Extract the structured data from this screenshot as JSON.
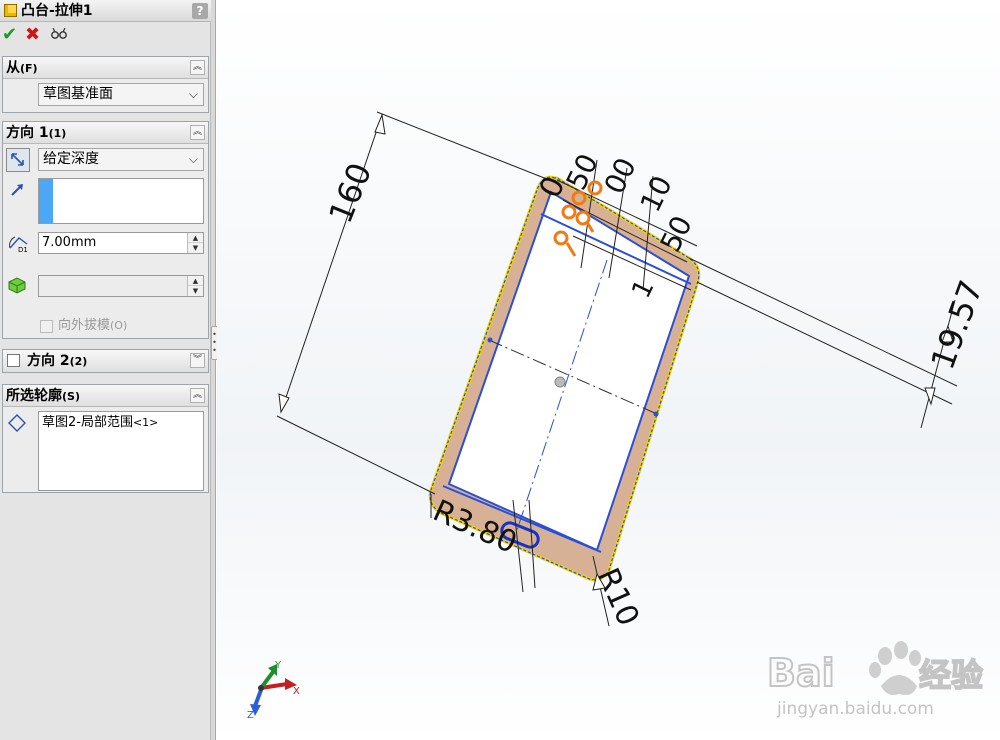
{
  "feature": {
    "title": "凸台-拉伸1",
    "help_glyph": "?"
  },
  "actions": {
    "ok_glyph": "✔",
    "cancel_glyph": "✖",
    "preview_glyph": "6̸6"
  },
  "from_group": {
    "title": "从",
    "shortcut": "(F)",
    "selected": "草图基准面"
  },
  "direction1": {
    "title": "方向 1",
    "shortcut": "(1)",
    "end_condition": "给定深度",
    "depth": "7.00mm",
    "draft_label": "向外拔模",
    "draft_shortcut": "(O)"
  },
  "direction2": {
    "title": "方向 2",
    "shortcut": "(2)"
  },
  "contours": {
    "title": "所选轮廓",
    "shortcut": "(S)",
    "item": "草图2-局部范围",
    "item_count": "<1>"
  },
  "dimensions": {
    "d1": "160",
    "d2": "19.57",
    "d3": "R3.80",
    "d4": "R10"
  },
  "triad": {
    "x": "X",
    "y": "Y",
    "z": "Z"
  },
  "watermark": {
    "brand": "Bai",
    "brand_cn": "经验",
    "url": "jingyan.baidu.com"
  },
  "colors": {
    "sketch": "#2a4fd6",
    "selection_fill": "#d4a98a",
    "highlight": "#f1d400",
    "relation": "#f07b14",
    "ok": "#1a9b22",
    "cancel": "#d31414"
  }
}
